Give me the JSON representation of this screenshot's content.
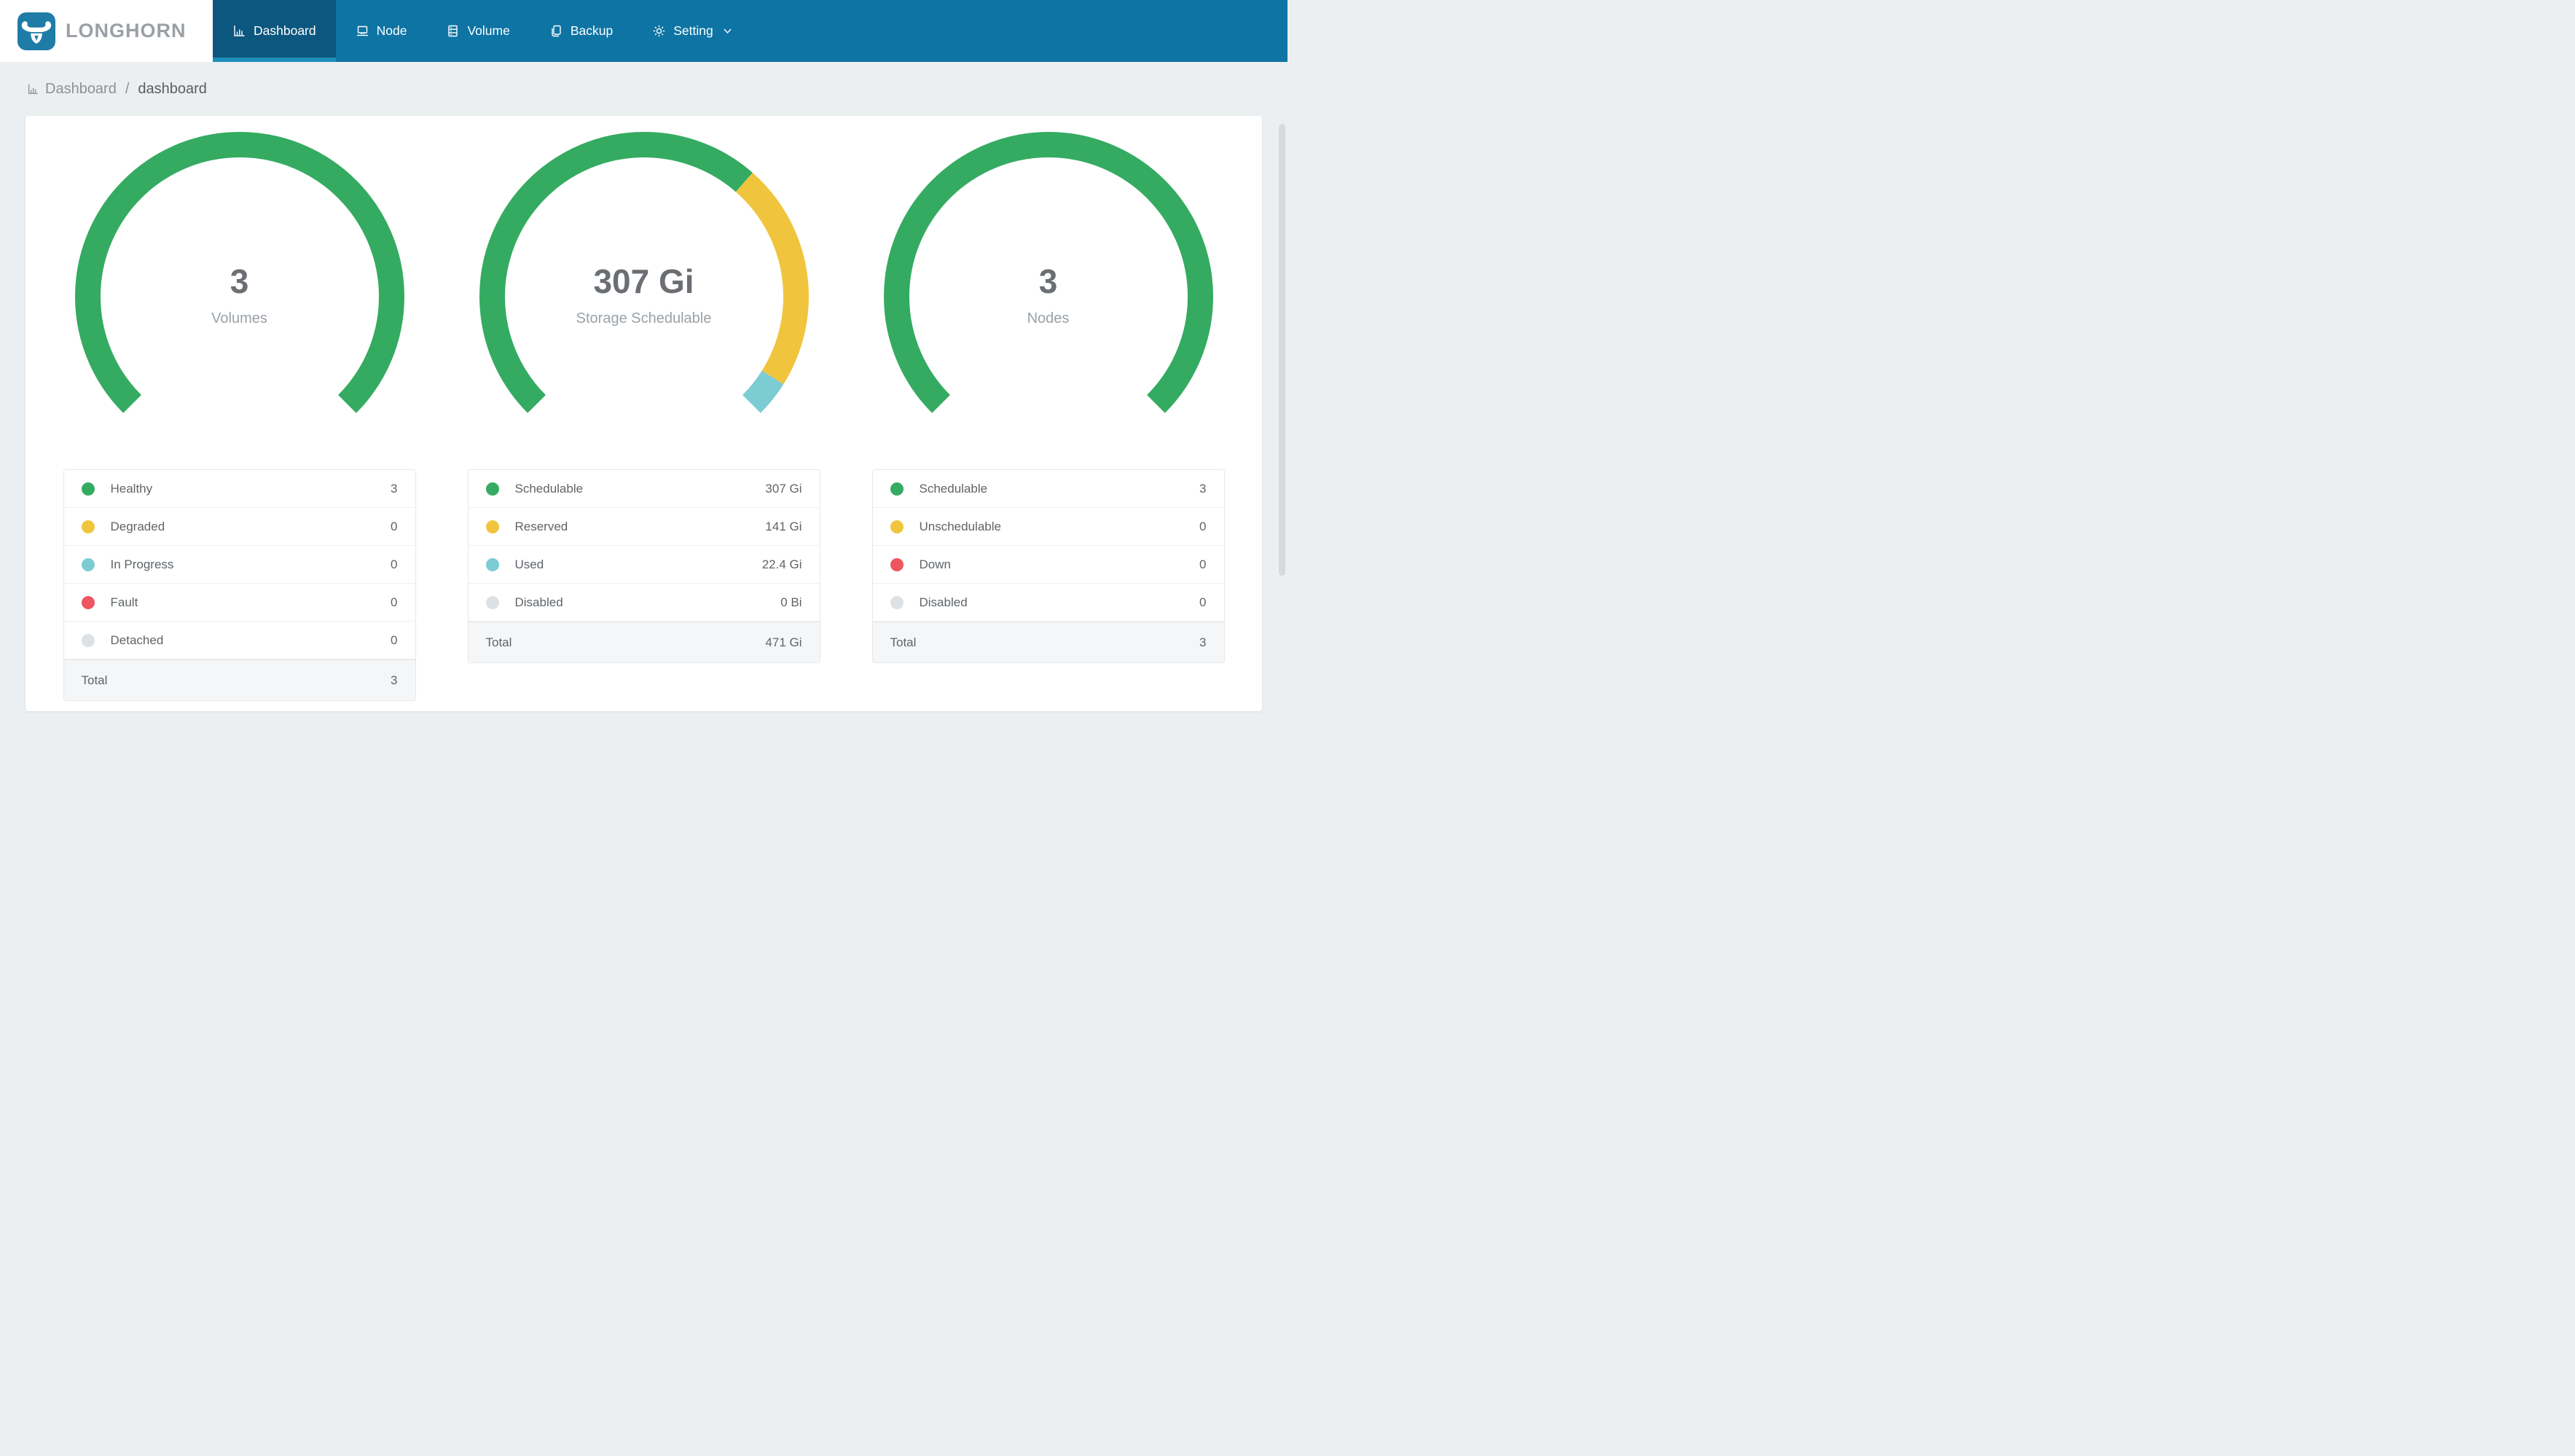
{
  "theme": {
    "navbar_bg": "#0e74a4",
    "navbar_active_bg": "#0c577f",
    "navbar_active_underline": "#1f8fba",
    "brand_blue": "#1e7ca6",
    "brand_text": "#9aa0a5",
    "page_bg": "#eceff1",
    "card_bg": "#ffffff",
    "status_green": "#34ab61",
    "status_yellow": "#f0c53d",
    "status_teal": "#7cccd4",
    "status_red": "#ee5560",
    "status_gray": "#dee1e4",
    "text_dark": "#6b6f73",
    "text_muted": "#9aa1a7",
    "legend_text": "#5f6468"
  },
  "brand": {
    "name": "LONGHORN"
  },
  "navbar": {
    "items": [
      {
        "label": "Dashboard",
        "icon": "bar-chart-icon",
        "active": true
      },
      {
        "label": "Node",
        "icon": "node-icon"
      },
      {
        "label": "Volume",
        "icon": "volume-icon"
      },
      {
        "label": "Backup",
        "icon": "backup-icon"
      },
      {
        "label": "Setting",
        "icon": "gear-icon",
        "chevron": true
      }
    ]
  },
  "breadcrumb": {
    "root": "Dashboard",
    "separator": "/",
    "current": "dashboard"
  },
  "chart_data": [
    {
      "type": "donut",
      "title": "Volumes",
      "center_value": "3",
      "center_label": "Volumes",
      "arc_span_degrees": 270,
      "start_angle_degrees": -135,
      "legend_position": "below",
      "categories": [
        "Healthy",
        "Degraded",
        "In Progress",
        "Fault",
        "Detached"
      ],
      "values": [
        3,
        0,
        0,
        0,
        0
      ],
      "display_values": [
        "3",
        "0",
        "0",
        "0",
        "0"
      ],
      "colors": [
        "#34ab61",
        "#f0c53d",
        "#7cccd4",
        "#ee5560",
        "#dee1e4"
      ],
      "total_label": "Total",
      "total_value": 3,
      "total_display": "3"
    },
    {
      "type": "donut",
      "title": "Storage Schedulable",
      "center_value": "307 Gi",
      "center_label": "Storage Schedulable",
      "arc_span_degrees": 270,
      "start_angle_degrees": -135,
      "legend_position": "below",
      "categories": [
        "Schedulable",
        "Reserved",
        "Used",
        "Disabled"
      ],
      "values": [
        307,
        141,
        22.4,
        0
      ],
      "display_values": [
        "307 Gi",
        "141 Gi",
        "22.4 Gi",
        "0 Bi"
      ],
      "colors": [
        "#34ab61",
        "#f0c53d",
        "#7cccd4",
        "#dee1e4"
      ],
      "total_label": "Total",
      "total_value": 471,
      "total_display": "471 Gi"
    },
    {
      "type": "donut",
      "title": "Nodes",
      "center_value": "3",
      "center_label": "Nodes",
      "arc_span_degrees": 270,
      "start_angle_degrees": -135,
      "legend_position": "below",
      "categories": [
        "Schedulable",
        "Unschedulable",
        "Down",
        "Disabled"
      ],
      "values": [
        3,
        0,
        0,
        0
      ],
      "display_values": [
        "3",
        "0",
        "0",
        "0"
      ],
      "colors": [
        "#34ab61",
        "#f0c53d",
        "#ee5560",
        "#dee1e4"
      ],
      "total_label": "Total",
      "total_value": 3,
      "total_display": "3"
    }
  ]
}
